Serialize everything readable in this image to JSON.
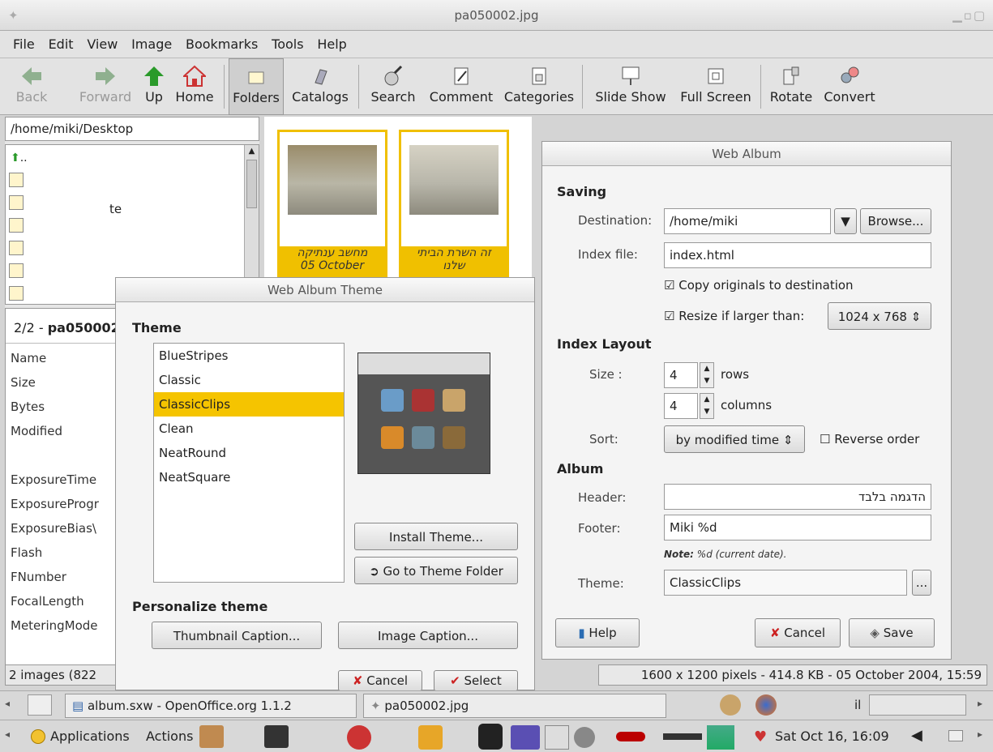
{
  "window": {
    "title": "pa050002.jpg"
  },
  "menu": [
    "File",
    "Edit",
    "View",
    "Image",
    "Bookmarks",
    "Tools",
    "Help"
  ],
  "toolbar": {
    "back": "Back",
    "forward": "Forward",
    "up": "Up",
    "home": "Home",
    "folders": "Folders",
    "catalogs": "Catalogs",
    "search": "Search",
    "comment": "Comment",
    "categories": "Categories",
    "slideshow": "Slide Show",
    "fullscreen": "Full Screen",
    "rotate": "Rotate",
    "convert": "Convert"
  },
  "sidebar": {
    "path": "/home/miki/Desktop",
    "up_item": "..",
    "partial_item": "te",
    "count": "2/2 - ",
    "filename": "pa050002",
    "props": [
      "Name",
      "Size",
      "Bytes",
      "Modified",
      "ExposureTime",
      "ExposureProgr",
      "ExposureBias\\",
      "Flash",
      "FNumber",
      "FocalLength",
      "MeteringMode"
    ],
    "status": "2 images (822"
  },
  "thumbs": [
    {
      "caption": "מחשב ענתיקה",
      "date": "05 October"
    },
    {
      "caption": "זה השרת הביתי",
      "line2": "שלנו"
    }
  ],
  "statusbar": "1600 x 1200 pixels - 414.8 KB - 05 October 2004, 15:59",
  "theme_dialog": {
    "title": "Web Album Theme",
    "theme_header": "Theme",
    "themes": [
      "BlueStripes",
      "Classic",
      "ClassicClips",
      "Clean",
      "NeatRound",
      "NeatSquare"
    ],
    "selected": "ClassicClips",
    "install": "Install Theme...",
    "goto": "Go to Theme Folder",
    "personalize": "Personalize theme",
    "thumb_caption": "Thumbnail Caption...",
    "image_caption": "Image Caption...",
    "cancel": "Cancel",
    "select": "Select"
  },
  "web_album": {
    "title": "Web Album",
    "saving": "Saving",
    "destination_label": "Destination:",
    "destination": "/home/miki",
    "browse": "Browse...",
    "index_label": "Index file:",
    "index": "index.html",
    "copy_originals": "Copy originals to destination",
    "resize": "Resize if larger than:",
    "resize_value": "1024 x 768",
    "index_layout": "Index Layout",
    "size_label": "Size :",
    "rows": "4",
    "rows_label": "rows",
    "cols": "4",
    "cols_label": "columns",
    "sort_label": "Sort:",
    "sort_value": "by modified time",
    "reverse": "Reverse order",
    "album": "Album",
    "header_label": "Header:",
    "header_value": "הדגמה בלבד",
    "footer_label": "Footer:",
    "footer_value": "Miki  %d",
    "note_bold": "Note:",
    "note_rest": "%d (current date).",
    "theme_label": "Theme:",
    "theme_value": "ClassicClips",
    "theme_btn": "...",
    "help": "Help",
    "cancel": "Cancel",
    "save": "Save"
  },
  "taskbar": {
    "task1": "album.sxw - OpenOffice.org 1.1.2",
    "task2": "pa050002.jpg",
    "indicator": "il",
    "applications": "Applications",
    "actions": "Actions",
    "clock": "Sat Oct 16, 16:09"
  }
}
